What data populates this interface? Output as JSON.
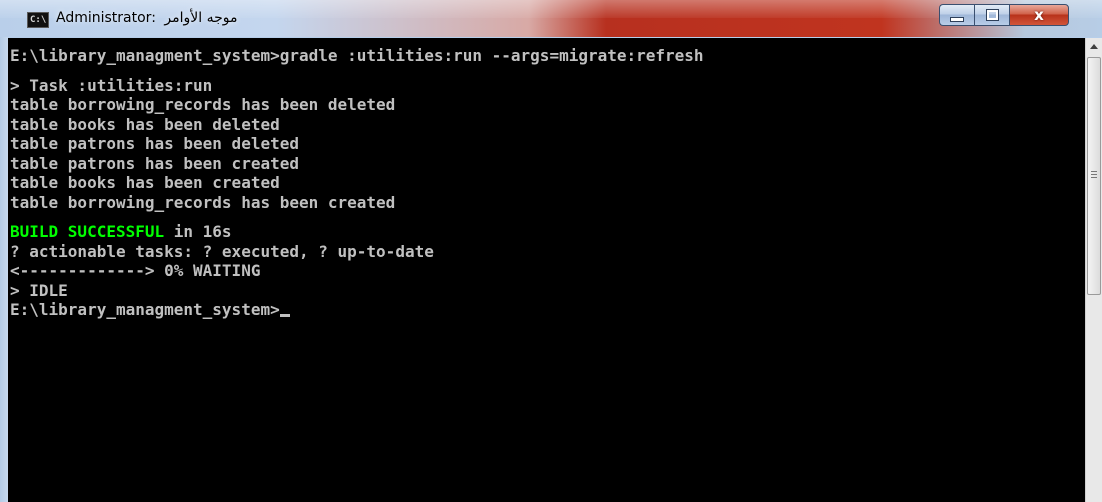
{
  "window": {
    "title_prefix": "Administrator:",
    "title_suffix": "موجه الأوامر",
    "icon_text": "C:\\",
    "close_symbol": "x"
  },
  "terminal": {
    "lines": [
      "E:\\library_managment_system>gradle :utilities:run --args=migrate:refresh",
      "",
      "> Task :utilities:run",
      "table borrowing_records has been deleted",
      "table books has been deleted",
      "table patrons has been deleted",
      "table patrons has been created",
      "table books has been created",
      "table borrowing_records has been created",
      "",
      "",
      "? actionable tasks: ? executed, ? up-to-date",
      "<-------------> 0% WAITING",
      "> IDLE",
      ""
    ],
    "build_status": "BUILD SUCCESSFUL",
    "build_time": " in 16s",
    "prompt": "E:\\library_managment_system>"
  },
  "colors": {
    "terminal_bg": "#000000",
    "terminal_text": "#c0c0c0",
    "success_text": "#00ff00",
    "close_button": "#c0341f"
  }
}
